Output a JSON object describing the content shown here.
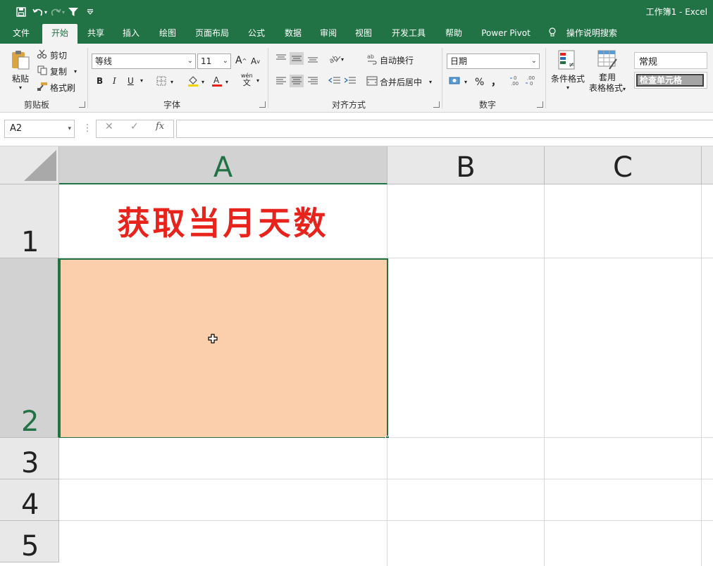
{
  "app": {
    "doc_title": "工作簿1  -  Excel"
  },
  "tabs": [
    "文件",
    "开始",
    "共享",
    "插入",
    "绘图",
    "页面布局",
    "公式",
    "数据",
    "审阅",
    "视图",
    "开发工具",
    "帮助",
    "Power Pivot"
  ],
  "tell_me": "操作说明搜索",
  "ribbon": {
    "clipboard": {
      "paste": "粘贴",
      "cut": "剪切",
      "copy": "复制",
      "format_painter": "格式刷",
      "label": "剪贴板"
    },
    "font": {
      "name": "等线",
      "size": "11",
      "bold": "B",
      "italic": "I",
      "underline": "U",
      "grow": "A",
      "shrink": "A",
      "label": "字体",
      "wen": "wén",
      "wen_char": "文"
    },
    "alignment": {
      "wrap": "自动换行",
      "merge": "合并后居中",
      "label": "对齐方式"
    },
    "number": {
      "format": "日期",
      "percent": "%",
      "comma": "，",
      "label": "数字"
    },
    "styles": {
      "conditional": "条件格式",
      "table_line1": "套用",
      "table_line2": "表格格式",
      "style_normal": "常规",
      "style_check": "检查单元格"
    }
  },
  "formula_bar": {
    "name_box": "A2",
    "cancel": "✕",
    "enter": "✓",
    "fx": "fx",
    "value": ""
  },
  "sheet": {
    "columns": [
      "A",
      "B",
      "C"
    ],
    "rows": [
      "1",
      "2",
      "3",
      "4",
      "5"
    ],
    "cells": {
      "A1": "获取当月天数",
      "A2": ""
    }
  },
  "colors": {
    "brand": "#217346",
    "title_red": "#e8231c",
    "selection_fill": "#fbcfab"
  }
}
